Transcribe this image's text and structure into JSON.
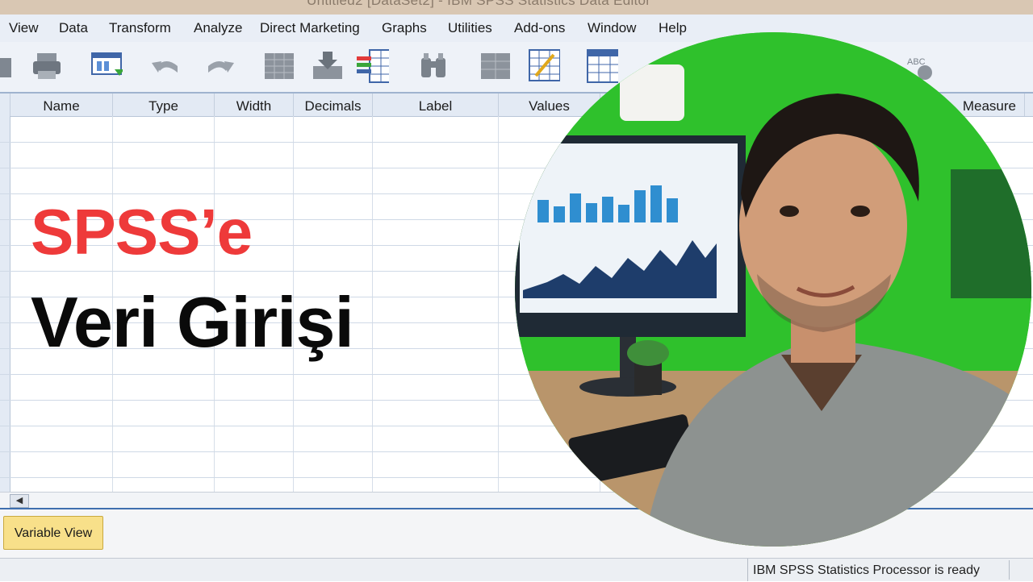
{
  "window": {
    "title": "Untitled2 [DataSet2] - IBM SPSS Statistics Data Editor"
  },
  "menu": [
    "View",
    "Data",
    "Transform",
    "Analyze",
    "Direct Marketing",
    "Graphs",
    "Utilities",
    "Add-ons",
    "Window",
    "Help"
  ],
  "toolbar": {
    "icons": [
      "open-icon",
      "print-icon",
      "dialog-recall-icon",
      "undo-icon",
      "redo-icon",
      "goto-case-icon",
      "insert-cases-icon",
      "insert-variable-icon",
      "find-icon",
      "split-file-icon",
      "weight-cases-icon",
      "value-labels-icon",
      "spell-check-icon"
    ],
    "spell_label": "ABC"
  },
  "grid": {
    "columns": [
      "Name",
      "Type",
      "Width",
      "Decimals",
      "Label",
      "Values",
      "Measure"
    ]
  },
  "tabs": {
    "variable_view": "Variable View"
  },
  "status": {
    "text": "IBM SPSS Statistics Processor is ready"
  },
  "headline": {
    "line1": "SPSS’e",
    "line2": "Veri Girişi"
  },
  "colors": {
    "accent_red": "#ee3a3a",
    "green_screen": "#2fc12c",
    "tab_yellow": "#f8e08a"
  }
}
